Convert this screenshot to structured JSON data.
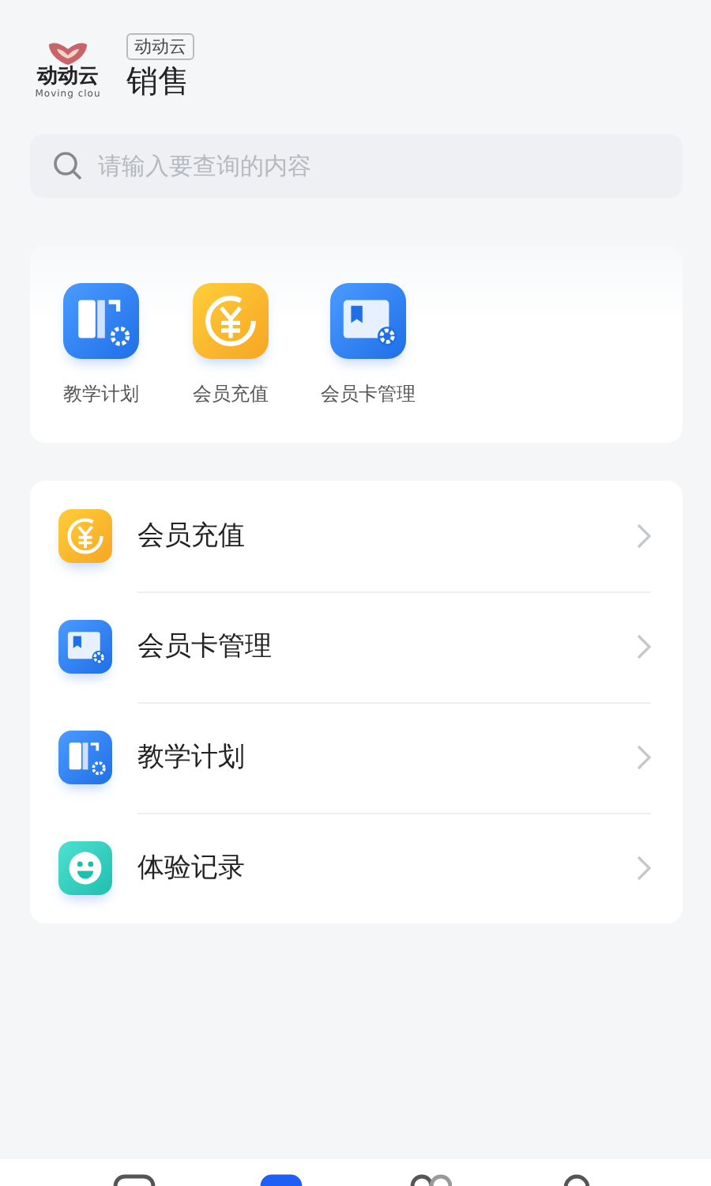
{
  "header": {
    "logo_text": "动动云",
    "logo_subtext": "Moving clou",
    "tag": "动动云",
    "title": "销售"
  },
  "search": {
    "placeholder": "请输入要查询的内容"
  },
  "shortcuts": [
    {
      "kind": "plan",
      "label": "教学计划"
    },
    {
      "kind": "recharge",
      "label": "会员充值"
    },
    {
      "kind": "card",
      "label": "会员卡管理"
    }
  ],
  "menu": [
    {
      "kind": "recharge",
      "label": "会员充值"
    },
    {
      "kind": "card",
      "label": "会员卡管理"
    },
    {
      "kind": "plan",
      "label": "教学计划"
    },
    {
      "kind": "smile",
      "label": "体验记录"
    }
  ],
  "tab_bar": [
    {
      "kind": "home",
      "selected": false
    },
    {
      "kind": "apps",
      "selected": true
    },
    {
      "kind": "people",
      "selected": false
    },
    {
      "kind": "user",
      "selected": false
    }
  ]
}
